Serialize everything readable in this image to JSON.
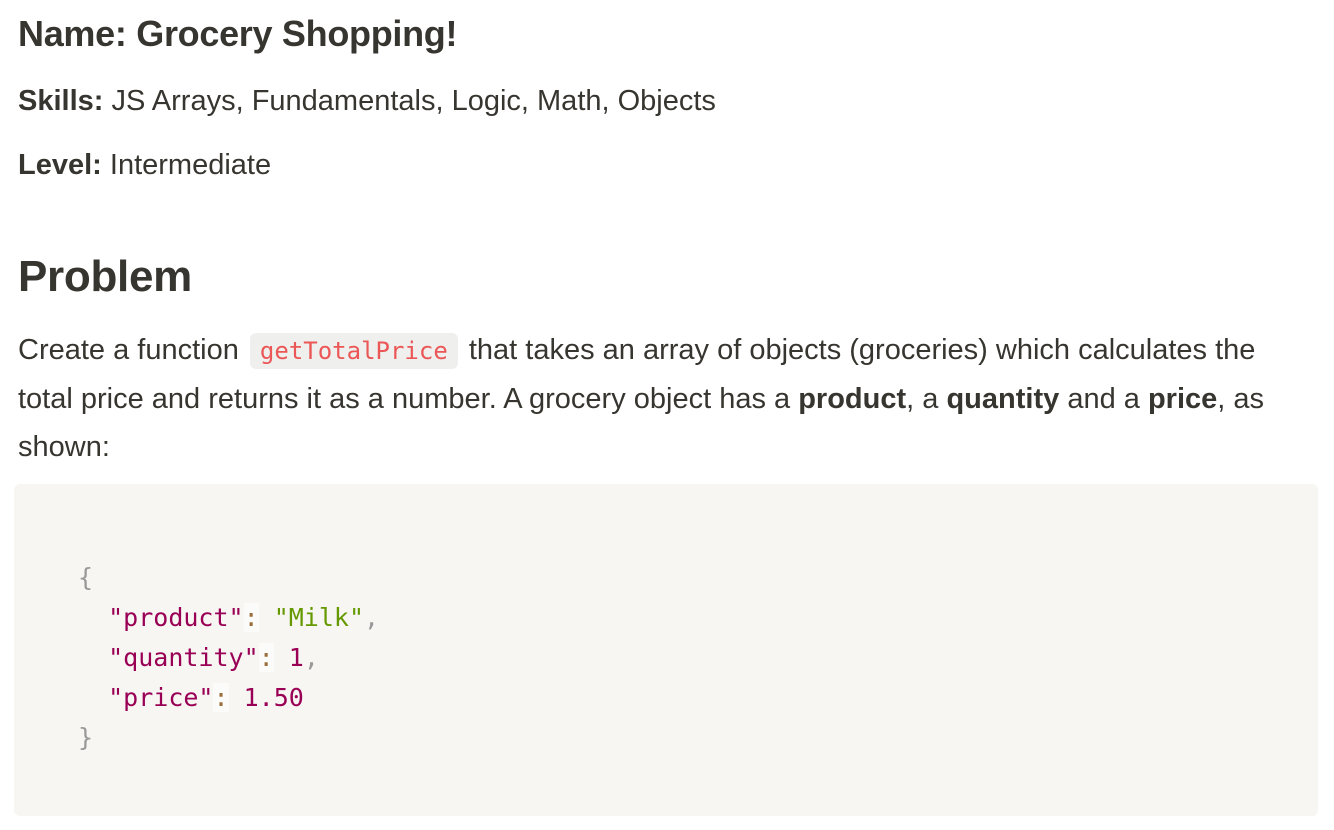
{
  "header": {
    "name_label": "Name:",
    "name_value": "Grocery Shopping!",
    "skills_label": "Skills:",
    "skills_value": "JS Arrays, Fundamentals, Logic, Math, Objects",
    "level_label": "Level:",
    "level_value": "Intermediate"
  },
  "problem": {
    "heading": "Problem",
    "text_1": "Create a function",
    "inline_code": "getTotalPrice",
    "text_2": "that takes an array of objects (groceries) which calculates the total price and returns it as a number. A grocery object has a",
    "bold_product": "product",
    "text_3": ", a",
    "bold_quantity": "quantity",
    "text_4": "and a",
    "bold_price": "price",
    "text_5": ", as shown:"
  },
  "code_example": {
    "open_brace": "{",
    "close_brace": "}",
    "lines": [
      {
        "key": "\"product\"",
        "colon": ":",
        "value": "\"Milk\"",
        "value_type": "string",
        "trail": ","
      },
      {
        "key": "\"quantity\"",
        "colon": ":",
        "value": "1",
        "value_type": "number",
        "trail": ","
      },
      {
        "key": "\"price\"",
        "colon": ":",
        "value": "1.50",
        "value_type": "number",
        "trail": ""
      }
    ]
  },
  "colors": {
    "text": "#37352f",
    "inline_code_text": "#eb5757",
    "inline_code_bg": "#efefed",
    "code_block_bg": "#f7f6f3",
    "code_key": "#990055",
    "code_string": "#669900",
    "code_number": "#990055",
    "code_punct": "#999999"
  }
}
